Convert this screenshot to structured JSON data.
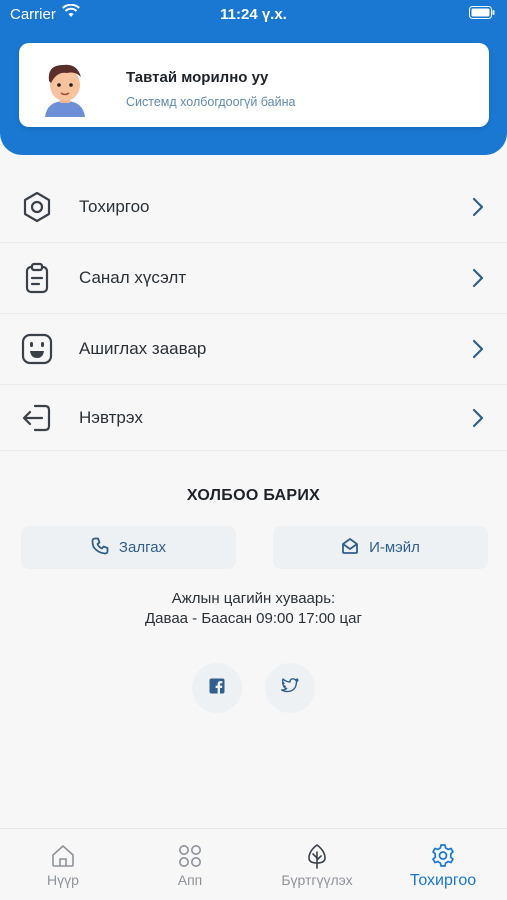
{
  "status_bar": {
    "carrier": "Carrier",
    "time": "11:24 ү.х."
  },
  "welcome": {
    "title": "Тавтай морилно уу",
    "subtitle": "Системд холбогдоогүй байна"
  },
  "menu": {
    "items": [
      {
        "label": "Тохиргоо",
        "icon": "hexagon-settings-icon"
      },
      {
        "label": "Санал хүсэлт",
        "icon": "clipboard-icon"
      },
      {
        "label": "Ашиглах заавар",
        "icon": "smiley-icon"
      },
      {
        "label": "Нэвтрэх",
        "icon": "login-icon"
      }
    ]
  },
  "contact": {
    "title": "ХОЛБОО БАРИХ",
    "call_label": "Залгах",
    "email_label": "И-мэйл",
    "hours_label": "Ажлын цагийн хуваарь:",
    "hours_value": "Даваа - Баасан 09:00 17:00 цаг"
  },
  "tabs": [
    {
      "label": "Нүүр",
      "icon": "home-icon",
      "active": false
    },
    {
      "label": "Апп",
      "icon": "apps-grid-icon",
      "active": false
    },
    {
      "label": "Бүртгүүлэх",
      "icon": "tree-icon",
      "active": false
    },
    {
      "label": "Тохиргоо",
      "icon": "gear-icon",
      "active": true
    }
  ],
  "colors": {
    "brand": "#1a78d2",
    "accent_text": "#2f5f8a",
    "background": "#f7f7f8"
  }
}
